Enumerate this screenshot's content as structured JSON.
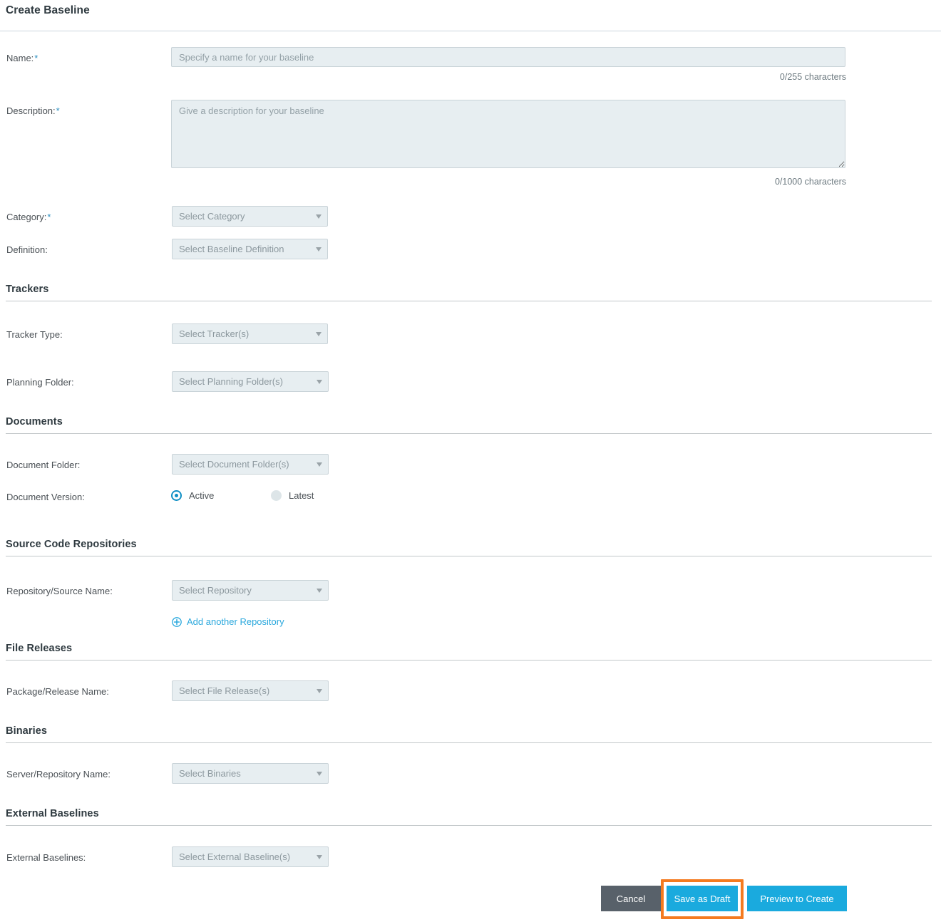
{
  "page": {
    "title": "Create Baseline"
  },
  "fields": {
    "name": {
      "label": "Name:",
      "required": "*",
      "placeholder": "Specify a name for your baseline",
      "value": "",
      "counter": "0/255 characters"
    },
    "description": {
      "label": "Description:",
      "required": "*",
      "placeholder": "Give a description for your baseline",
      "value": "",
      "counter": "0/1000 characters"
    },
    "category": {
      "label": "Category:",
      "required": "*",
      "selected": "Select Category"
    },
    "definition": {
      "label": "Definition:",
      "selected": "Select Baseline Definition"
    }
  },
  "sections": {
    "trackers": {
      "heading": "Trackers",
      "tracker_type": {
        "label": "Tracker Type:",
        "selected": "Select Tracker(s)"
      },
      "planning_folder": {
        "label": "Planning Folder:",
        "selected": "Select Planning Folder(s)"
      }
    },
    "documents": {
      "heading": "Documents",
      "document_folder": {
        "label": "Document Folder:",
        "selected": "Select Document Folder(s)"
      },
      "document_version": {
        "label": "Document Version:",
        "options": [
          {
            "label": "Active",
            "selected": true
          },
          {
            "label": "Latest",
            "selected": false
          }
        ]
      }
    },
    "source_code_repositories": {
      "heading": "Source Code Repositories",
      "repository_name": {
        "label": "Repository/Source Name:",
        "selected": "Select Repository"
      },
      "add_link": {
        "label": "Add another Repository",
        "icon": "circle-plus-icon"
      }
    },
    "file_releases": {
      "heading": "File Releases",
      "package_release_name": {
        "label": "Package/Release Name:",
        "selected": "Select File Release(s)"
      }
    },
    "binaries": {
      "heading": "Binaries",
      "server_repository_name": {
        "label": "Server/Repository Name:",
        "selected": "Select Binaries"
      }
    },
    "external_baselines": {
      "heading": "External Baselines",
      "external_baselines": {
        "label": "External Baselines:",
        "selected": "Select External Baseline(s)"
      }
    }
  },
  "footer": {
    "cancel": "Cancel",
    "save_as_draft": "Save as Draft",
    "preview_to_create": "Preview to Create",
    "highlighted_button": "Save as Draft"
  },
  "colors": {
    "accent_blue": "#1aaade",
    "link_blue": "#2aa8dd",
    "radio_blue": "#0d8ec4",
    "cancel_gray": "#58616a",
    "highlight_orange": "#f47b20",
    "field_bg": "#e7eef1",
    "field_border": "#c9d3d8",
    "rule_gray": "#c2c7c9",
    "heading_text": "#2f3a40"
  }
}
